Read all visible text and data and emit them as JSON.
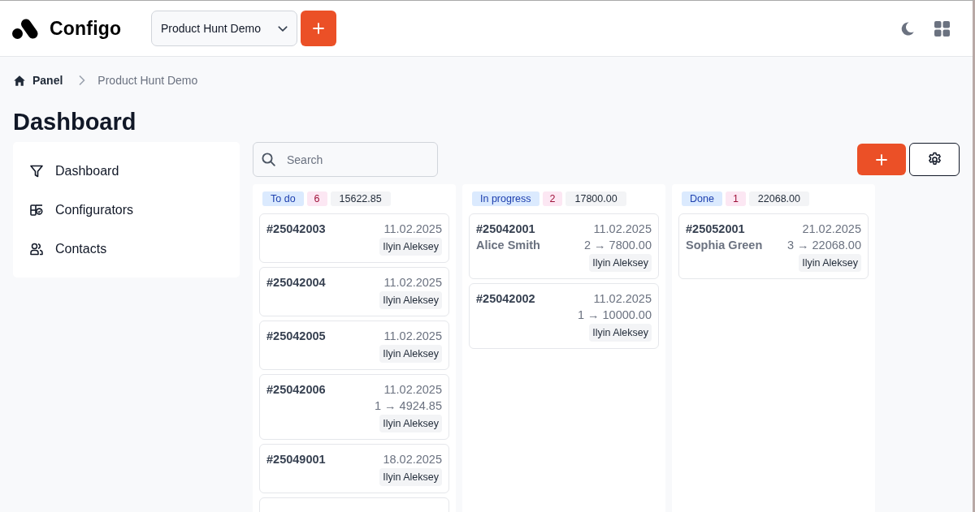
{
  "header": {
    "logo": "Configo",
    "project_select": {
      "value": "Product Hunt Demo"
    }
  },
  "breadcrumb": [
    {
      "label": "Panel"
    },
    {
      "label": "Product Hunt Demo"
    }
  ],
  "page_title": "Dashboard",
  "sidebar": {
    "items": [
      {
        "label": "Dashboard"
      },
      {
        "label": "Configurators"
      },
      {
        "label": "Contacts"
      }
    ]
  },
  "search": {
    "placeholder": "Search"
  },
  "board": {
    "columns": [
      {
        "title": "To do",
        "count": "6",
        "total": "15622.85",
        "cards": [
          {
            "kind": "order",
            "number": "#25042003",
            "date": "11.02.2025",
            "assignee": "Ilyin Aleksey"
          },
          {
            "kind": "order",
            "number": "#25042004",
            "date": "11.02.2025",
            "assignee": "Ilyin Aleksey"
          },
          {
            "kind": "order",
            "number": "#25042005",
            "date": "11.02.2025",
            "assignee": "Ilyin Aleksey"
          },
          {
            "kind": "order",
            "number": "#25042006",
            "date": "11.02.2025",
            "amount": "1 → 4924.85",
            "assignee": "Ilyin Aleksey"
          },
          {
            "kind": "order",
            "number": "#25049001",
            "date": "18.02.2025",
            "assignee": "Ilyin Aleksey"
          },
          {
            "kind": "partial"
          }
        ]
      },
      {
        "title": "In progress",
        "count": "2",
        "total": "17800.00",
        "cards": [
          {
            "kind": "order",
            "number": "#25042001",
            "customer": "Alice Smith",
            "date": "11.02.2025",
            "amount": "2 → 7800.00",
            "assignee": "Ilyin Aleksey"
          },
          {
            "kind": "order",
            "number": "#25042002",
            "date": "11.02.2025",
            "amount": "1 → 10000.00",
            "assignee": "Ilyin Aleksey"
          }
        ]
      },
      {
        "title": "Done",
        "count": "1",
        "total": "22068.00",
        "cards": [
          {
            "kind": "order",
            "number": "#25052001",
            "customer": "Sophia Green",
            "date": "21.02.2025",
            "amount": "3 → 22068.00",
            "assignee": "Ilyin Aleksey"
          }
        ]
      }
    ]
  }
}
